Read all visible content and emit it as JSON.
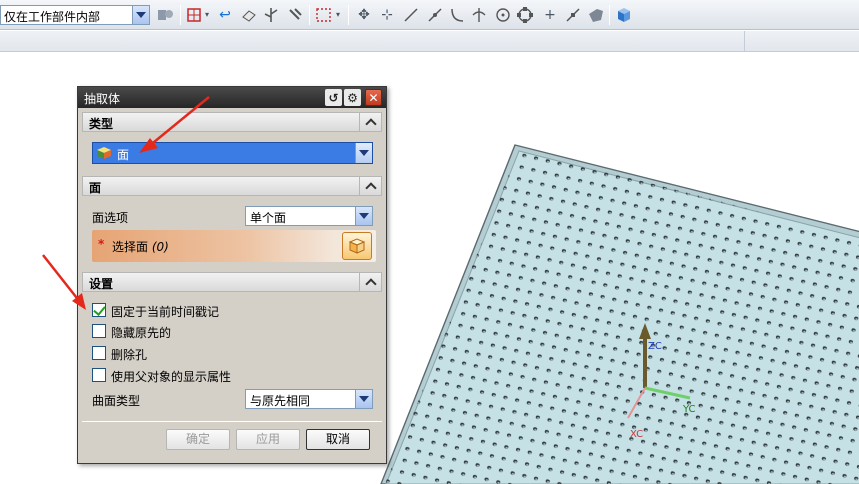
{
  "toolbar": {
    "selection_filter": "仅在工作部件内部",
    "icons": [
      "filter-scope-icon",
      "snap-select-icon",
      "undo-icon",
      "erase-icon",
      "branch-icon",
      "deselect-icon",
      "box-select-icon",
      "crosshair-icon",
      "move-icon",
      "line-icon",
      "line-point-icon",
      "arc-icon",
      "intersection-icon",
      "circle-center-icon",
      "quadrant-icon",
      "plus-point-icon",
      "tangent-icon",
      "face-icon",
      "cube-icon"
    ]
  },
  "dialog": {
    "title": "抽取体",
    "sections": {
      "type": {
        "label": "类型",
        "selected": "面"
      },
      "face": {
        "label": "面",
        "face_option_label": "面选项",
        "face_option_value": "单个面",
        "select_face_label": "选择面",
        "select_face_count": "(0)"
      },
      "settings": {
        "label": "设置",
        "checkboxes": [
          {
            "label": "固定于当前时间戳记",
            "checked": true
          },
          {
            "label": "隐藏原先的",
            "checked": false
          },
          {
            "label": "删除孔",
            "checked": false
          },
          {
            "label": "使用父对象的显示属性",
            "checked": false
          }
        ],
        "surface_type_label": "曲面类型",
        "surface_type_value": "与原先相同"
      }
    },
    "buttons": {
      "ok": "确定",
      "apply": "应用",
      "cancel": "取消"
    }
  },
  "viewport": {
    "axis_labels": {
      "z": "ZC",
      "y": "YC",
      "x": "XC"
    },
    "plate_color": "#c6e1e6",
    "arrow_color": "#e5281c"
  }
}
